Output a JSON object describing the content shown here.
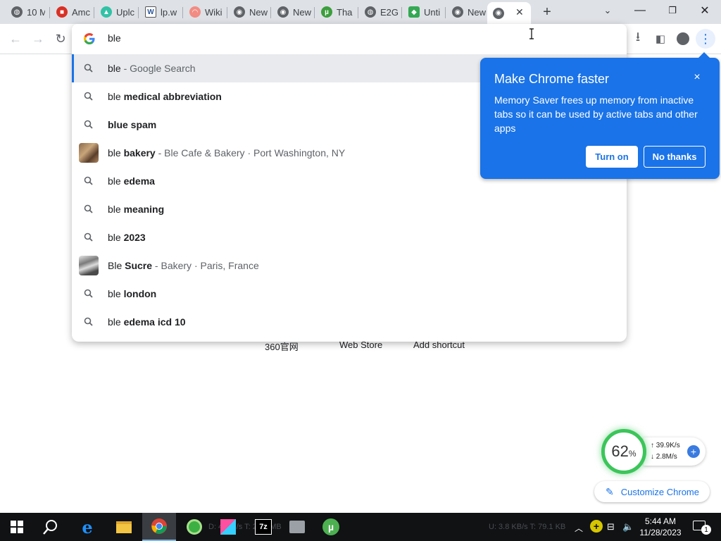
{
  "tabs": [
    {
      "title": "10 M",
      "icon": "globe-icon"
    },
    {
      "title": "Amc",
      "icon": "lock-icon"
    },
    {
      "title": "Uplc",
      "icon": "upload-icon"
    },
    {
      "title": "lp.w",
      "icon": "word-icon"
    },
    {
      "title": "Wiki",
      "icon": "gauge-icon"
    },
    {
      "title": "New",
      "icon": "chrome-icon"
    },
    {
      "title": "New",
      "icon": "chrome-icon"
    },
    {
      "title": "Tha",
      "icon": "utorrent-icon"
    },
    {
      "title": "E2G",
      "icon": "globe-icon"
    },
    {
      "title": "Unti",
      "icon": "gamepad-icon"
    },
    {
      "title": "New",
      "icon": "chrome-icon"
    }
  ],
  "omnibox": {
    "input_text": "ble",
    "suggestions": [
      {
        "prefix": "ble",
        "bold": "",
        "desc": " - Google Search",
        "kind": "search",
        "selected": true
      },
      {
        "prefix": "ble ",
        "bold": "medical abbreviation",
        "desc": "",
        "kind": "search"
      },
      {
        "prefix": "",
        "bold": "blue spam",
        "desc": "",
        "kind": "search"
      },
      {
        "prefix": "ble ",
        "bold": "bakery",
        "desc": " - Ble Cafe & Bakery · Port Washington, NY",
        "kind": "entity"
      },
      {
        "prefix": "ble ",
        "bold": "edema",
        "desc": "",
        "kind": "search"
      },
      {
        "prefix": "ble ",
        "bold": "meaning",
        "desc": "",
        "kind": "search"
      },
      {
        "prefix": "ble ",
        "bold": "2023",
        "desc": "",
        "kind": "search"
      },
      {
        "prefix": "Ble ",
        "bold": "Sucre",
        "desc": " - Bakery · Paris, France",
        "kind": "entity"
      },
      {
        "prefix": "ble ",
        "bold": "london",
        "desc": "",
        "kind": "search"
      },
      {
        "prefix": "ble ",
        "bold": "edema icd 10",
        "desc": "",
        "kind": "search"
      }
    ]
  },
  "shortcuts": [
    "360官网",
    "Web Store",
    "Add shortcut"
  ],
  "iph": {
    "title": "Make Chrome faster",
    "body": "Memory Saver frees up memory from inactive tabs so it can be used by active tabs and other apps",
    "turn_on": "Turn on",
    "no_thanks": "No thanks",
    "close": "×"
  },
  "widget": {
    "percent": "62",
    "percent_unit": "%",
    "upload": "39.9K/s",
    "download": "2.8M/s"
  },
  "customize": {
    "label": "Customize Chrome"
  },
  "taskbar": {
    "time": "5:44 AM",
    "date": "11/28/2023",
    "notification_count": "1",
    "ghost_left": "D: 4 MB/s T: 29.1 MB",
    "ghost_right": "U: 3.8 KB/s T: 79.1 KB"
  },
  "colors": {
    "accent": "#1a73e8",
    "tabstrip": "#dee1e6",
    "ring": "#3cc55a",
    "taskbar": "#101214"
  }
}
